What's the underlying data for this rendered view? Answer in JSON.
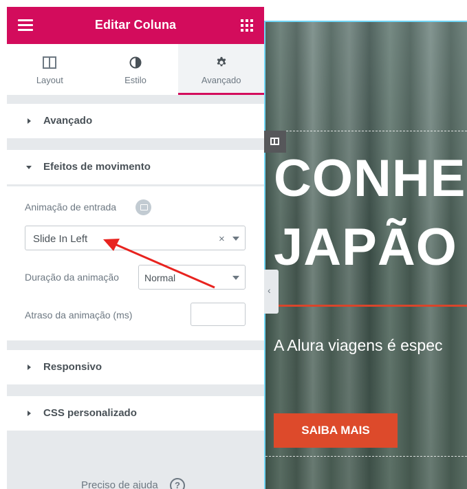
{
  "panel": {
    "title": "Editar Coluna",
    "tabs": [
      {
        "label": "Layout",
        "icon": "columns-icon"
      },
      {
        "label": "Estilo",
        "icon": "half-circle-icon"
      },
      {
        "label": "Avançado",
        "icon": "gear-icon",
        "active": true
      }
    ],
    "sections": {
      "advanced": "Avançado",
      "motion": "Efeitos de movimento",
      "responsive": "Responsivo",
      "custom_css": "CSS personalizado"
    },
    "motion_controls": {
      "entrance_label": "Animação de entrada",
      "entrance_value": "Slide In Left",
      "clear": "×",
      "duration_label": "Duração da animação",
      "duration_value": "Normal",
      "delay_label": "Atraso da animação (ms)",
      "delay_value": ""
    },
    "help_text": "Preciso de ajuda",
    "help_symbol": "?",
    "accent_color": "#d30c5c"
  },
  "preview": {
    "heading_line1": "CONHE",
    "heading_line2": "JAPÃO",
    "subtext": "A Alura viagens é espec",
    "button_label": "SAIBA MAIS",
    "button_color": "#dd4a2b",
    "collapse_glyph": "‹"
  },
  "annotation": {
    "arrow_color": "#e8231f"
  }
}
